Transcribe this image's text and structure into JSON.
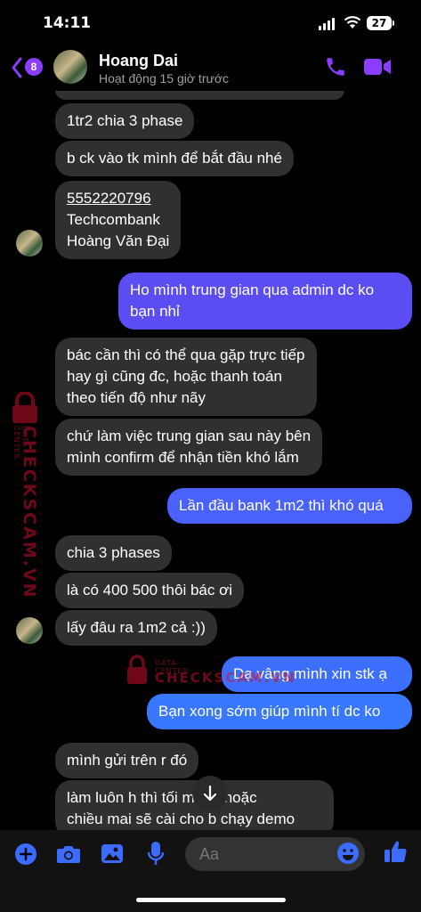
{
  "status_bar": {
    "time": "14:11",
    "battery": "27"
  },
  "header": {
    "back_badge": "8",
    "contact_name": "Hoang Dai",
    "contact_status": "Hoạt động 15 giờ trước"
  },
  "messages": [
    {
      "side": "in",
      "lines": [
        "1tr2 chia 3 phase"
      ]
    },
    {
      "side": "in",
      "lines": [
        "b ck vào tk mình để bắt đầu nhé"
      ]
    },
    {
      "side": "in",
      "lines": [
        "5552220796",
        "Techcombank",
        "Hoàng Văn Đại"
      ]
    },
    {
      "side": "out",
      "lines": [
        "Ho mình trung gian qua admin dc ko",
        "bạn nhỉ"
      ]
    },
    {
      "side": "in",
      "lines": [
        "bác cần thì có thể qua gặp trực tiếp",
        "hay gì cũng đc, hoặc thanh toán",
        "theo tiến độ như nãy"
      ]
    },
    {
      "side": "in",
      "lines": [
        "chứ làm việc trung gian sau này bên",
        "mình confirm để nhận tiền khó lắm"
      ]
    },
    {
      "side": "out",
      "lines": [
        "Lần đầu bank 1m2 thì khó quá"
      ]
    },
    {
      "side": "in",
      "lines": [
        "chia 3 phases"
      ]
    },
    {
      "side": "in",
      "lines": [
        "là có 400 500 thôi bác ơi"
      ]
    },
    {
      "side": "in",
      "lines": [
        "lấy đâu ra 1m2 cả :))"
      ]
    },
    {
      "side": "out",
      "lines": [
        "Dạ vâng mình xin stk ạ"
      ]
    },
    {
      "side": "out",
      "lines": [
        "Bạn xong sớm giúp mình tí dc ko"
      ]
    },
    {
      "side": "in",
      "lines": [
        "mình gửi trên r đó"
      ]
    },
    {
      "side": "in",
      "lines": [
        "làm luôn h thì tối muộn hoặc",
        "chiều mai sẽ cài cho b chạy demo"
      ]
    }
  ],
  "watermark": {
    "brand": "CHECKSCAM.VN",
    "tag": "DATA CENTER"
  },
  "composer": {
    "placeholder": "Aa"
  },
  "colors": {
    "accent": "#8b3dff",
    "outgoing": "#5c4df2",
    "incoming": "#303030",
    "watermark": "#c8102e"
  },
  "icons": [
    "back-chevron-icon",
    "phone-call-icon",
    "video-call-icon",
    "plus-icon",
    "camera-icon",
    "image-icon",
    "microphone-icon",
    "emoji-icon",
    "thumbs-up-icon",
    "arrow-down-icon",
    "lock-icon"
  ]
}
